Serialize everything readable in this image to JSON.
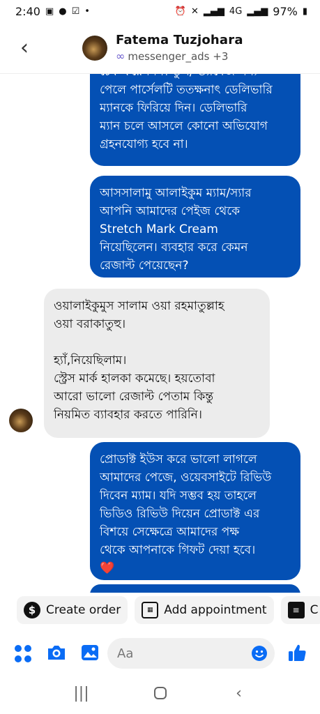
{
  "status_bar": {
    "time": "2:40",
    "battery": "97%",
    "network_label": "4G"
  },
  "header": {
    "contact_name": "Fatema Tuzjohara",
    "subtitle": "messenger_ads +3"
  },
  "messages": [
    {
      "direction": "outgoing",
      "lines": [
        "চেক করে নিন। ভুল/ ড্যামেজ পণ্য",
        "পেলে পার্সেলটি ততক্ষনাৎ ডেলিভারি",
        "ম্যানকে ফিরিয়ে দিন। ডেলিভারি",
        "ম্যান চলে আসলে কোনো অভিযোগ",
        "গ্রহনযোগ্য হবে না।"
      ]
    },
    {
      "direction": "outgoing",
      "lines": [
        "আসসালামু আলাইকুম ম্যাম/স্যার",
        "আপনি আমাদের পেইজ থেকে",
        "Stretch Mark Cream",
        "নিয়েছিলেন। ব্যবহার করে কেমন",
        "রেজাল্ট পেয়েছেন?"
      ]
    },
    {
      "direction": "incoming",
      "lines": [
        "ওয়ালাইকুমুস সালাম ওয়া রহমাতুল্লাহ",
        "ওয়া বরাকাতুহু।",
        "",
        "হ্যাঁ,নিয়েছিলাম।",
        "স্ট্রেস মার্ক হালকা কমেছে। হয়তোবা",
        "আরো ভালো রেজাল্ট পেতাম কিন্তু",
        "নিয়মিত ব্যাবহার করতে পারিনি।"
      ]
    },
    {
      "direction": "outgoing",
      "lines": [
        "প্রোডাক্ট ইউস করে ভালো লাগলে",
        "আমাদের পেজে, ওয়েবসাইটে রিভিউ",
        "দিবেন ম্যাম। যদি সম্ভব হয় তাহলে",
        "ভিডিও রিভিউ দিয়েন প্রোডাক্ট এর",
        "বিশয়ে সেক্ষেত্রে আমাদের পক্ষ",
        "থেকে আপনাকে গিফট দেয়া হবে।"
      ],
      "emoji": "❤️"
    }
  ],
  "quick_actions": [
    {
      "label": "Create order",
      "icon": "dollar-icon"
    },
    {
      "label": "Add appointment",
      "icon": "calendar-icon"
    },
    {
      "label": "C",
      "icon": "document-icon"
    }
  ],
  "composer": {
    "placeholder": "Aa"
  },
  "colors": {
    "outgoing_bubble": "#0450b4",
    "incoming_bubble": "#ececec",
    "accent": "#0a6cf5"
  }
}
